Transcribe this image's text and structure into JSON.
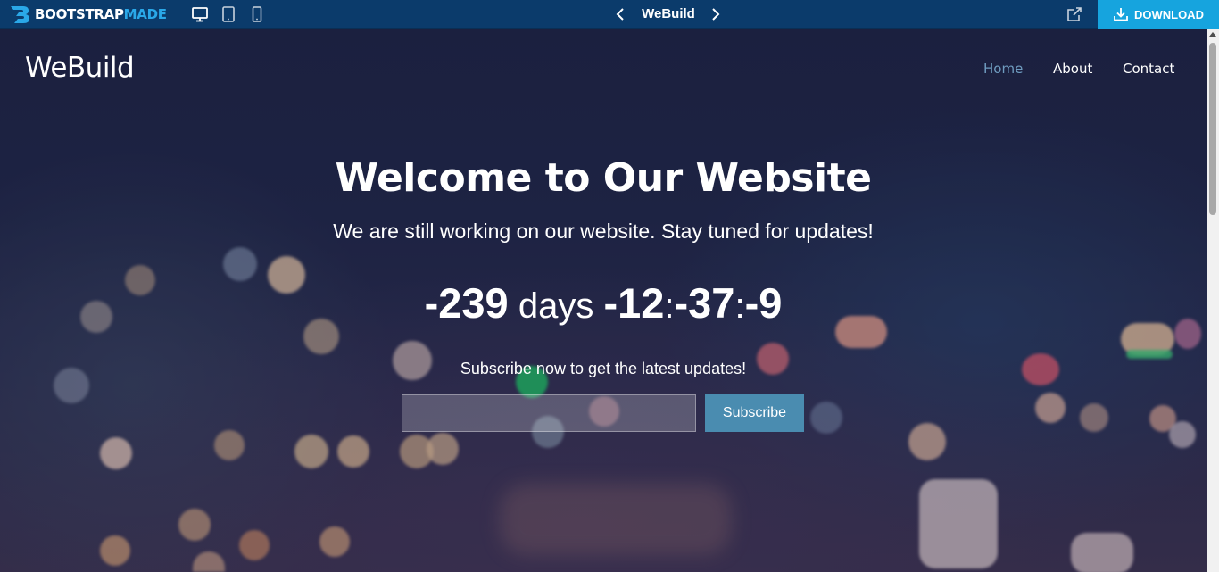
{
  "preview_bar": {
    "brand_part1": "BOOTSTRAP",
    "brand_part2": "MADE",
    "title": "WeBuild",
    "download_label": "DOWNLOAD",
    "icons": [
      "desktop-icon",
      "tablet-icon",
      "mobile-icon",
      "chevron-left-icon",
      "chevron-right-icon",
      "external-link-icon",
      "download-icon"
    ],
    "colors": {
      "bar": "#0b3b6b",
      "accent": "#16a4de",
      "brand_blue": "#2aa8e8"
    }
  },
  "site": {
    "logo": "WeBuild",
    "nav": [
      "Home",
      "About",
      "Contact"
    ],
    "active_nav": "Home"
  },
  "hero": {
    "title": "Welcome to Our Website",
    "subtitle": "We are still working on our website. Stay tuned for updates!",
    "countdown": {
      "days": "-239",
      "days_label": "days",
      "hours": "-12",
      "minutes": "-37",
      "seconds": "-9",
      "separator": ":"
    },
    "subscribe_text": "Subscribe now to get the latest updates!",
    "email_value": "",
    "button_label": "Subscribe"
  },
  "colors": {
    "nav_active": "#6f9cc0",
    "button": "#4a8cb0"
  }
}
